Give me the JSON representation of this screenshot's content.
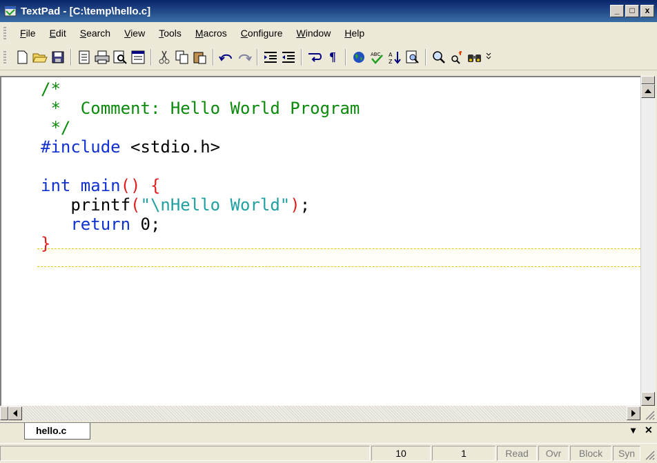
{
  "window": {
    "title": "TextPad - [C:\\temp\\hello.c]",
    "controls": {
      "minimize": "_",
      "maximize": "□",
      "close": "x"
    }
  },
  "menu": [
    {
      "label": "File",
      "accel": "F",
      "rest": "ile"
    },
    {
      "label": "Edit",
      "accel": "E",
      "rest": "dit"
    },
    {
      "label": "Search",
      "accel": "S",
      "rest": "earch"
    },
    {
      "label": "View",
      "accel": "V",
      "rest": "iew"
    },
    {
      "label": "Tools",
      "accel": "T",
      "rest": "ools"
    },
    {
      "label": "Macros",
      "accel": "M",
      "rest": "acros"
    },
    {
      "label": "Configure",
      "accel": "C",
      "rest": "onfigure"
    },
    {
      "label": "Window",
      "accel": "W",
      "rest": "indow"
    },
    {
      "label": "Help",
      "accel": "H",
      "rest": "elp"
    }
  ],
  "toolbar_icons": [
    "new-file-icon",
    "open-folder-icon",
    "save-icon",
    "save-all-icon",
    "print-icon",
    "print-preview-icon",
    "document-properties-icon",
    "cut-icon",
    "copy-icon",
    "paste-icon",
    "undo-icon",
    "redo-icon",
    "indent-icon",
    "outdent-icon",
    "word-wrap-icon",
    "pilcrow-icon",
    "web-browser-icon",
    "spell-check-icon",
    "sort-icon",
    "find-in-files-icon",
    "find-icon",
    "replace-icon",
    "binoculars-icon",
    "toolbar-overflow-icon"
  ],
  "code": {
    "line1": "/*",
    "line2": " *  Comment: Hello World Program",
    "line3": " */",
    "include_kw": "#include",
    "include_hdr": " <stdio.h>",
    "int_kw": "int",
    "main_fn": " main",
    "parens": "()",
    "open_brace": " {",
    "printf_fn": "   printf",
    "open_paren": "(",
    "string": "\"\\nHello World\"",
    "close_paren": ")",
    "semi1": ";",
    "return_kw": "   return",
    "zero": " 0;",
    "close_brace": "}"
  },
  "tabs": [
    {
      "label": "hello.c"
    }
  ],
  "tab_controls": {
    "dropdown": "▾",
    "close": "✕"
  },
  "status": {
    "line": "10",
    "column": "1",
    "read": "Read",
    "ovr": "Ovr",
    "block": "Block",
    "syn": "Syn"
  },
  "colors": {
    "comment": "#0a8a0a",
    "keyword": "#1030d0",
    "bracket": "#e02020",
    "string": "#20a0a0",
    "titlebar": "#0a246a"
  }
}
